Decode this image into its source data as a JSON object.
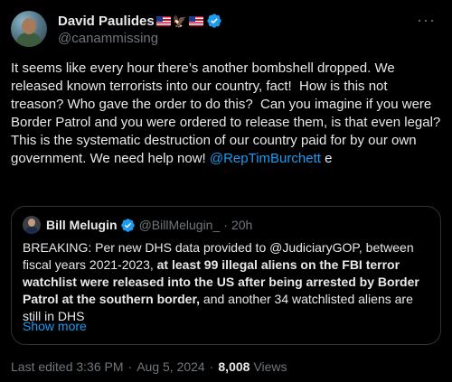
{
  "author": {
    "display_name": "David Paulides",
    "name_emojis": [
      "us-flag",
      "eagle",
      "us-flag"
    ],
    "handle": "@canammissing",
    "verified": true
  },
  "menu": {
    "more_label": "···"
  },
  "tweet": {
    "line_1": "It seems like every hour there’s another bombshell dropped. We released known terrorists into our country, fact!  How is this not treason? Who gave the order to do this?  Can you imagine if you were Border Patrol and you were ordered to release them, is that even legal?",
    "line_2_prefix": "This is the systematic destruction of our country paid for by our own government. We need help now! ",
    "mention": "@RepTimBurchett",
    "line_2_suffix": " e"
  },
  "quoted": {
    "display_name": "Bill Melugin",
    "handle": "@BillMelugin_",
    "separator": "·",
    "time": "20h",
    "text_intro": "BREAKING: Per new DHS data provided to @JudiciaryGOP, between fiscal years 2021-2023, ",
    "text_bold": "at least 99 illegal aliens on the FBI terror watchlist were released into the US after being arrested by Border Patrol at the southern border,",
    "text_outro": " and another 34 watchlisted aliens are still in DHS",
    "show_more": "Show more"
  },
  "footer": {
    "edited": "Last edited 3:36 PM",
    "sep1": "·",
    "date": "Aug 5, 2024",
    "sep2": "·",
    "views_count": "8,008",
    "views_label": "Views"
  },
  "colors": {
    "background": "#000000",
    "text": "#e7e9ea",
    "muted": "#71767b",
    "link": "#1d9bf0",
    "border": "#2f3336"
  }
}
